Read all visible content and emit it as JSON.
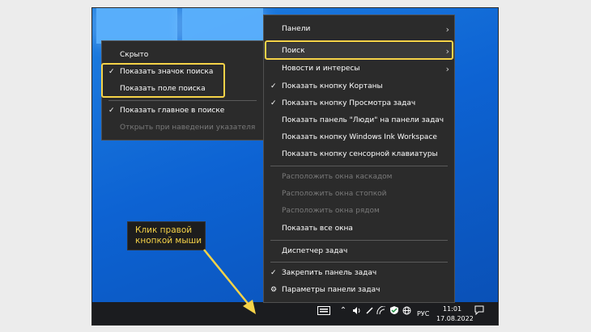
{
  "submenu": {
    "items": [
      {
        "label": "Скрыто",
        "checked": false,
        "disabled": false
      },
      {
        "label": "Показать значок поиска",
        "checked": true,
        "disabled": false
      },
      {
        "label": "Показать поле поиска",
        "checked": false,
        "disabled": false
      },
      {
        "label": "Показать главное в поиске",
        "checked": true,
        "disabled": false
      },
      {
        "label": "Открыть при наведении указателя",
        "checked": false,
        "disabled": true
      }
    ]
  },
  "context_menu": {
    "items": [
      {
        "label": "Панели",
        "arrow": true
      },
      {
        "label": "Поиск",
        "arrow": true
      },
      {
        "label": "Новости и интересы",
        "arrow": true
      },
      {
        "label": "Показать кнопку Кортаны",
        "checked": true
      },
      {
        "label": "Показать кнопку Просмотра задач",
        "checked": true
      },
      {
        "label": "Показать панель \"Люди\" на панели задач"
      },
      {
        "label": "Показать кнопку Windows Ink Workspace"
      },
      {
        "label": "Показать кнопку сенсорной клавиатуры"
      },
      {
        "label": "Расположить окна каскадом",
        "disabled": true
      },
      {
        "label": "Расположить окна стопкой",
        "disabled": true
      },
      {
        "label": "Расположить окна рядом",
        "disabled": true
      },
      {
        "label": "Показать все окна"
      },
      {
        "label": "Диспетчер задач"
      },
      {
        "label": "Закрепить панель задач",
        "checked": true
      },
      {
        "label": "Параметры панели задач",
        "icon": "gear-icon"
      }
    ]
  },
  "callout": {
    "text": "Клик правой\nкнопкой мыши"
  },
  "taskbar": {
    "language": "РУС",
    "time": "11:01",
    "date": "17.08.2022"
  },
  "colors": {
    "highlight": "#f6d348",
    "menu_bg": "#2b2b2b",
    "desktop": "#0d63d3"
  }
}
